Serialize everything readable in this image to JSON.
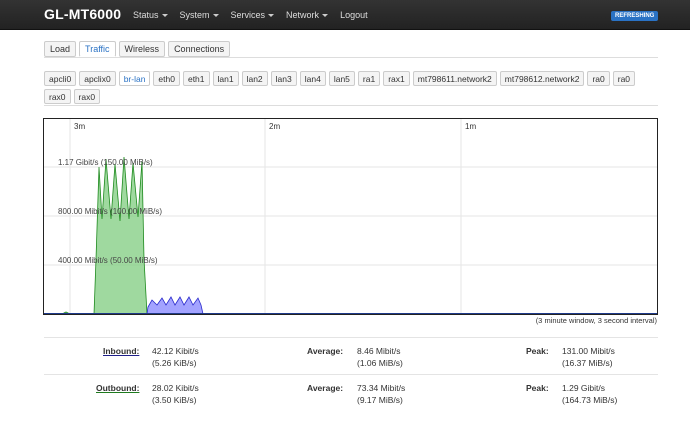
{
  "navbar": {
    "brand": "GL-MT6000",
    "menu": [
      "Status",
      "System",
      "Services",
      "Network"
    ],
    "logout": "Logout",
    "badge": "REFRESHING"
  },
  "tabs": [
    "Load",
    "Traffic",
    "Wireless",
    "Connections"
  ],
  "active_tab": "Traffic",
  "interfaces": [
    "apcli0",
    "apclix0",
    "br-lan",
    "eth0",
    "eth1",
    "lan1",
    "lan2",
    "lan3",
    "lan4",
    "lan5",
    "ra1",
    "rax1",
    "mt798611.network2",
    "mt798612.network2",
    "ra0",
    "ra0",
    "rax0",
    "rax0"
  ],
  "active_interface": "br-lan",
  "graph": {
    "time_labels": [
      "3m",
      "2m",
      "1m"
    ],
    "scale_labels": [
      "1.17 Gibit/s (150.00 MiB/s)",
      "800.00 Mibit/s (100.00 MiB/s)",
      "400.00 Mibit/s (50.00 MiB/s)"
    ],
    "note": "(3 minute window, 3 second interval)",
    "colors": {
      "inbound": "#0000ff",
      "outbound": "#008000"
    }
  },
  "stats": {
    "inbound": {
      "label": "Inbound:",
      "current": "42.12 Kibit/s",
      "current_bytes": "(5.26 KiB/s)",
      "avg_label": "Average:",
      "average": "8.46 Mibit/s",
      "average_bytes": "(1.06 MiB/s)",
      "peak_label": "Peak:",
      "peak": "131.00 Mibit/s",
      "peak_bytes": "(16.37 MiB/s)"
    },
    "outbound": {
      "label": "Outbound:",
      "current": "28.02 Kibit/s",
      "current_bytes": "(3.50 KiB/s)",
      "avg_label": "Average:",
      "average": "73.34 Mibit/s",
      "average_bytes": "(9.17 MiB/s)",
      "peak_label": "Peak:",
      "peak": "1.29 Gibit/s",
      "peak_bytes": "(164.73 MiB/s)"
    }
  }
}
